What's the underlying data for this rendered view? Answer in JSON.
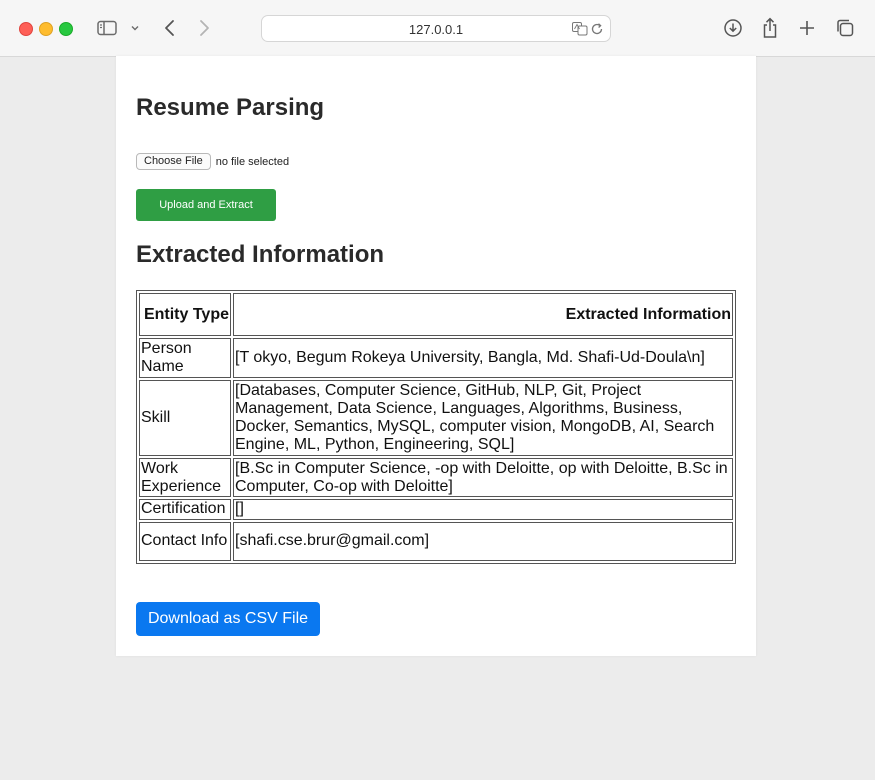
{
  "browser": {
    "url": "127.0.0.1",
    "icons": [
      "sidebar-icon",
      "chevron-down-icon",
      "back-icon",
      "forward-icon",
      "translate-icon",
      "reload-icon",
      "download-icon",
      "share-icon",
      "new-tab-icon",
      "tab-overview-icon"
    ]
  },
  "page": {
    "title": "Resume Parsing",
    "file_button": "Choose File",
    "file_status": "no file selected",
    "upload_button": "Upload and Extract",
    "section_title": "Extracted Information",
    "table": {
      "headers": [
        "Entity Type",
        "Extracted Information"
      ],
      "rows": [
        {
          "type": "Person Name",
          "value": "[T okyo, Begum Rokeya University, Bangla, Md. Shafi-Ud-Doula\\n]"
        },
        {
          "type": "Skill",
          "value": "[Databases, Computer Science, GitHub, NLP, Git, Project Management, Data Science, Languages, Algorithms, Business, Docker, Semantics, MySQL, computer vision, MongoDB, AI, Search Engine, ML, Python, Engineering, SQL]"
        },
        {
          "type": "Work Experience",
          "value": "[B.Sc in Computer Science, -op with Deloitte, op with Deloitte, B.Sc in Computer, Co-op with Deloitte]"
        },
        {
          "type": "Certification",
          "value": "[]"
        },
        {
          "type": "Contact Info",
          "value": "[shafi.cse.brur@gmail.com]"
        }
      ]
    },
    "download_button": "Download as CSV File",
    "colors": {
      "upload": "#2f9e44",
      "download": "#0a78f0"
    }
  }
}
